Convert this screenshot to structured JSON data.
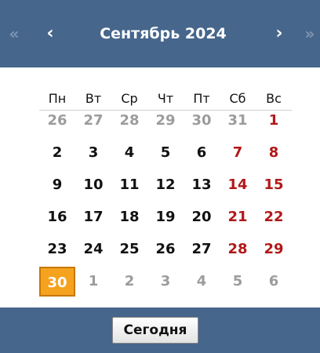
{
  "header": {
    "title": "Сентябрь 2024",
    "prev_year": "«",
    "prev_month": "‹",
    "next_month": "›",
    "next_year": "»"
  },
  "weekdays": [
    "Пн",
    "Вт",
    "Ср",
    "Чт",
    "Пт",
    "Сб",
    "Вс"
  ],
  "weeks": [
    [
      "26",
      "27",
      "28",
      "29",
      "30",
      "31",
      "1"
    ],
    [
      "2",
      "3",
      "4",
      "5",
      "6",
      "7",
      "8"
    ],
    [
      "9",
      "10",
      "11",
      "12",
      "13",
      "14",
      "15"
    ],
    [
      "16",
      "17",
      "18",
      "19",
      "20",
      "21",
      "22"
    ],
    [
      "23",
      "24",
      "25",
      "26",
      "27",
      "28",
      "29"
    ],
    [
      "30",
      "1",
      "2",
      "3",
      "4",
      "5",
      "6"
    ]
  ],
  "selected_day": "30",
  "footer": {
    "today_label": "Сегодня"
  },
  "colors": {
    "header_bg": "#46668c",
    "weekend": "#b11919",
    "outside_month": "#9c9c9c",
    "selected_bg": "#f5a21e",
    "selected_border": "#c87800"
  }
}
